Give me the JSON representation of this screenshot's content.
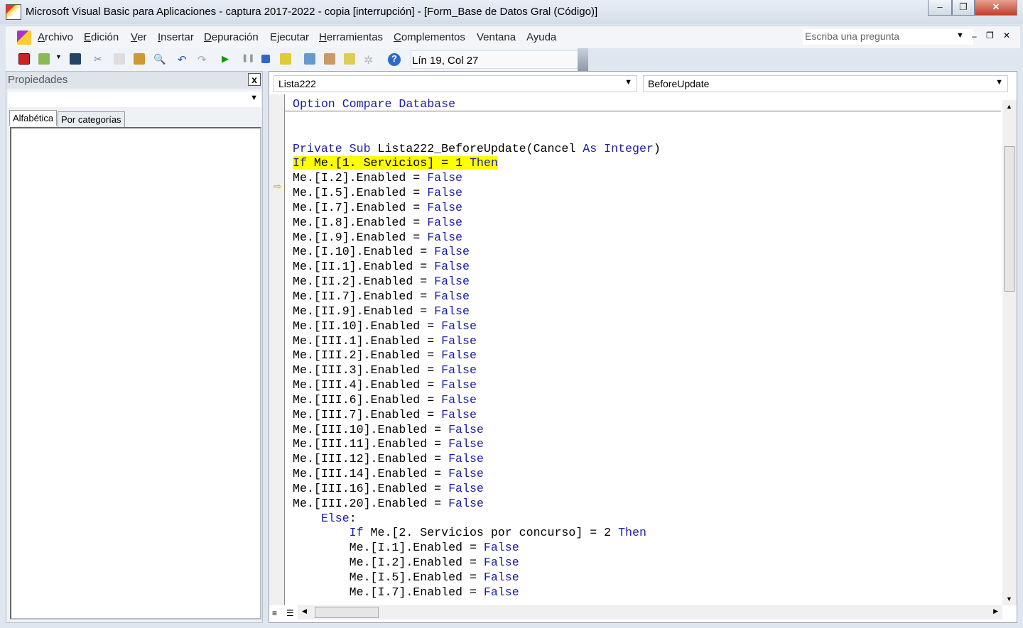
{
  "window": {
    "title": "Microsoft Visual Basic para Aplicaciones - captura 2017-2022 - copia [interrupción] - [Form_Base de Datos Gral (Código)]"
  },
  "menu": [
    {
      "label": "Archivo",
      "u": "A",
      "rest": "rchivo"
    },
    {
      "label": "Edición",
      "u": "E",
      "rest": "dición"
    },
    {
      "label": "Ver",
      "u": "V",
      "rest": "er"
    },
    {
      "label": "Insertar",
      "u": "I",
      "rest": "nsertar"
    },
    {
      "label": "Depuración",
      "u": "D",
      "rest": "epuración"
    },
    {
      "label": "Ejecutar",
      "u": "",
      "rest": "Ejecutar"
    },
    {
      "label": "Herramientas",
      "u": "H",
      "rest": "erramientas"
    },
    {
      "label": "Complementos",
      "u": "C",
      "rest": "omplementos"
    },
    {
      "label": "Ventana",
      "u": "",
      "rest": "Ventana"
    },
    {
      "label": "Ayuda",
      "u": "",
      "rest": "Ayuda"
    }
  ],
  "help_placeholder": "Escriba una pregunta",
  "toolbar": {
    "position": "Lín 19, Col 27"
  },
  "properties": {
    "title": "Propiedades",
    "tabs": [
      "Alfabética",
      "Por categorías"
    ]
  },
  "code_window": {
    "object": "Lista222",
    "procedure": "BeforeUpdate",
    "header_line": [
      [
        "Option Compare Database",
        "k"
      ]
    ],
    "lines": [
      [],
      [],
      [
        [
          "Private Sub ",
          "k"
        ],
        [
          "Lista222_BeforeUpdate(Cancel ",
          "p"
        ],
        [
          "As Integer",
          "k"
        ],
        [
          ")",
          "p"
        ]
      ],
      [
        [
          "If",
          "k"
        ],
        [
          " Me.[1. Servicios] = 1 ",
          "p"
        ],
        [
          "Then",
          "k"
        ]
      ],
      [
        [
          "Me.[I.2].Enabled = ",
          "p"
        ],
        [
          "False",
          "k"
        ]
      ],
      [
        [
          "Me.[I.5].Enabled = ",
          "p"
        ],
        [
          "False",
          "k"
        ]
      ],
      [
        [
          "Me.[I.7].Enabled = ",
          "p"
        ],
        [
          "False",
          "k"
        ]
      ],
      [
        [
          "Me.[I.8].Enabled = ",
          "p"
        ],
        [
          "False",
          "k"
        ]
      ],
      [
        [
          "Me.[I.9].Enabled = ",
          "p"
        ],
        [
          "False",
          "k"
        ]
      ],
      [
        [
          "Me.[I.10].Enabled = ",
          "p"
        ],
        [
          "False",
          "k"
        ]
      ],
      [
        [
          "Me.[II.1].Enabled = ",
          "p"
        ],
        [
          "False",
          "k"
        ]
      ],
      [
        [
          "Me.[II.2].Enabled = ",
          "p"
        ],
        [
          "False",
          "k"
        ]
      ],
      [
        [
          "Me.[II.7].Enabled = ",
          "p"
        ],
        [
          "False",
          "k"
        ]
      ],
      [
        [
          "Me.[II.9].Enabled = ",
          "p"
        ],
        [
          "False",
          "k"
        ]
      ],
      [
        [
          "Me.[II.10].Enabled = ",
          "p"
        ],
        [
          "False",
          "k"
        ]
      ],
      [
        [
          "Me.[III.1].Enabled = ",
          "p"
        ],
        [
          "False",
          "k"
        ]
      ],
      [
        [
          "Me.[III.2].Enabled = ",
          "p"
        ],
        [
          "False",
          "k"
        ]
      ],
      [
        [
          "Me.[III.3].Enabled = ",
          "p"
        ],
        [
          "False",
          "k"
        ]
      ],
      [
        [
          "Me.[III.4].Enabled = ",
          "p"
        ],
        [
          "False",
          "k"
        ]
      ],
      [
        [
          "Me.[III.6].Enabled = ",
          "p"
        ],
        [
          "False",
          "k"
        ]
      ],
      [
        [
          "Me.[III.7].Enabled = ",
          "p"
        ],
        [
          "False",
          "k"
        ]
      ],
      [
        [
          "Me.[III.10].Enabled = ",
          "p"
        ],
        [
          "False",
          "k"
        ]
      ],
      [
        [
          "Me.[III.11].Enabled = ",
          "p"
        ],
        [
          "False",
          "k"
        ]
      ],
      [
        [
          "Me.[III.12].Enabled = ",
          "p"
        ],
        [
          "False",
          "k"
        ]
      ],
      [
        [
          "Me.[III.14].Enabled = ",
          "p"
        ],
        [
          "False",
          "k"
        ]
      ],
      [
        [
          "Me.[III.16].Enabled = ",
          "p"
        ],
        [
          "False",
          "k"
        ]
      ],
      [
        [
          "Me.[III.20].Enabled = ",
          "p"
        ],
        [
          "False",
          "k"
        ]
      ],
      [
        [
          "    ",
          "p"
        ],
        [
          "Else",
          "k"
        ],
        [
          ":",
          "p"
        ]
      ],
      [
        [
          "        ",
          "p"
        ],
        [
          "If",
          "k"
        ],
        [
          " Me.[2. Servicios por concurso] = 2 ",
          "p"
        ],
        [
          "Then",
          "k"
        ]
      ],
      [
        [
          "        Me.[I.1].Enabled = ",
          "p"
        ],
        [
          "False",
          "k"
        ]
      ],
      [
        [
          "        Me.[I.2].Enabled = ",
          "p"
        ],
        [
          "False",
          "k"
        ]
      ],
      [
        [
          "        Me.[I.5].Enabled = ",
          "p"
        ],
        [
          "False",
          "k"
        ]
      ],
      [
        [
          "        Me.[I.7].Enabled = ",
          "p"
        ],
        [
          "False",
          "k"
        ]
      ]
    ],
    "current_line": 3
  },
  "colors": {
    "keyword": "#1c1ca8",
    "highlight": "#ffff00"
  }
}
